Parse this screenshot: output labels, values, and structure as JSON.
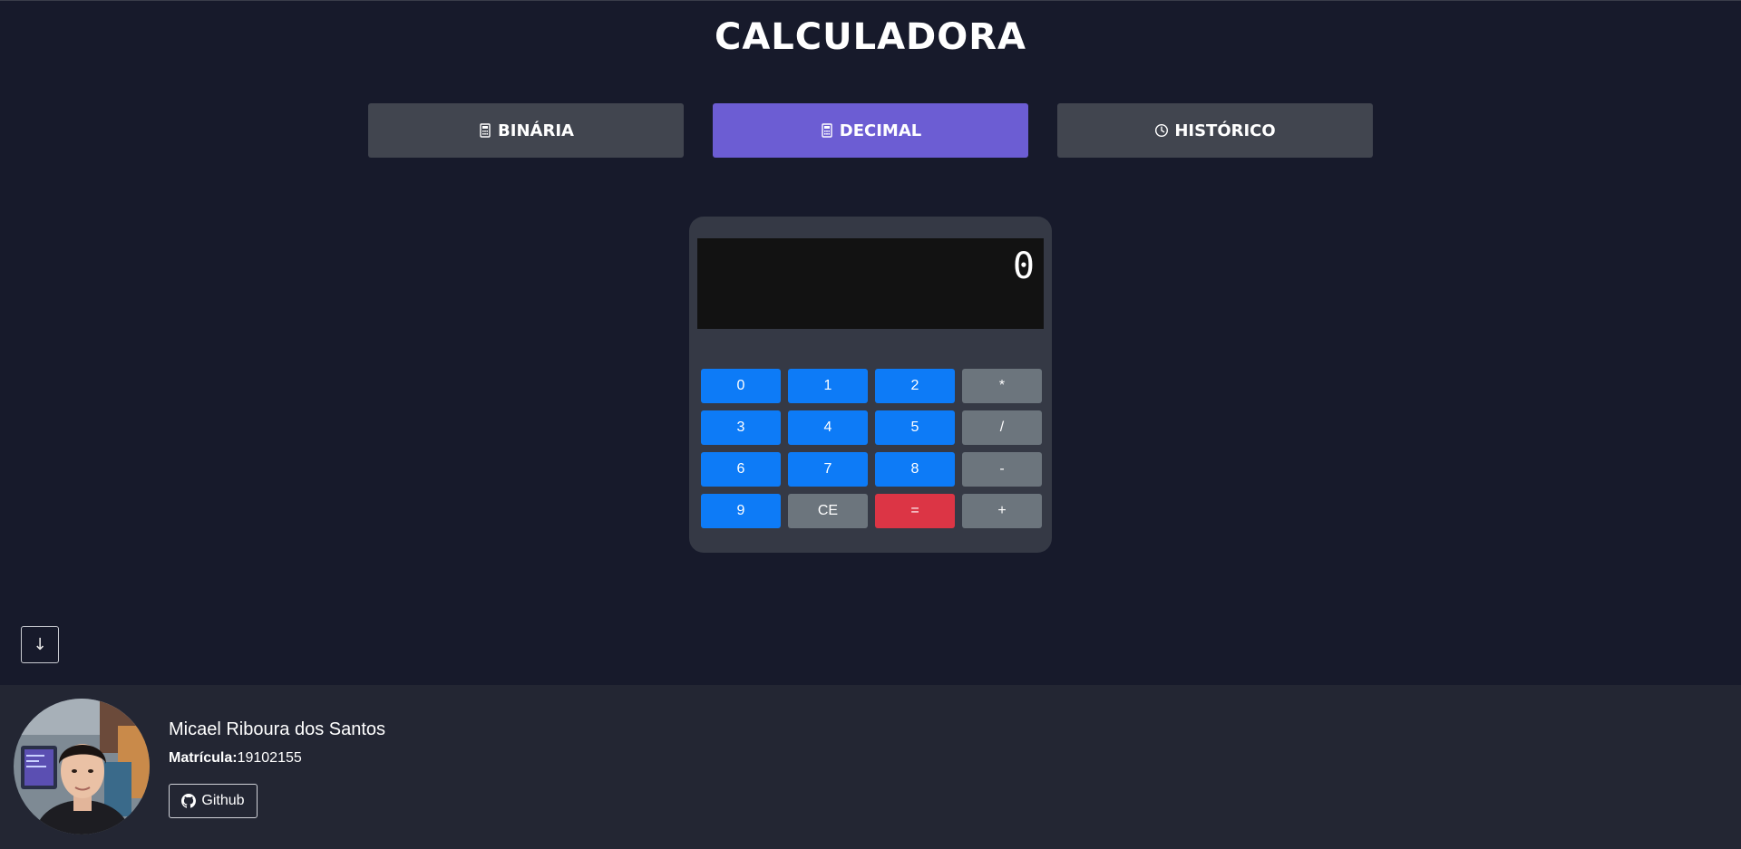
{
  "header": {
    "title": "CALCULADORA"
  },
  "tabs": [
    {
      "label": "BINÁRIA",
      "icon": "calculator-icon",
      "active": false
    },
    {
      "label": "DECIMAL",
      "icon": "calculator-icon",
      "active": true
    },
    {
      "label": "HISTÓRICO",
      "icon": "clock-icon",
      "active": false
    }
  ],
  "calculator": {
    "display": "0",
    "keys": [
      "0",
      "1",
      "2",
      "*",
      "3",
      "4",
      "5",
      "/",
      "6",
      "7",
      "8",
      "-",
      "9",
      "CE",
      "=",
      "+"
    ]
  },
  "scroll_button": {
    "symbol": "↓",
    "icon": "arrow-down-icon"
  },
  "footer": {
    "name": "Micael Riboura dos Santos",
    "matricula_label": "Matrícula:",
    "matricula_value": "19102155",
    "github_label": "Github"
  },
  "colors": {
    "background": "#171a2b",
    "footer": "#232633",
    "tab_active": "#6c5dd3",
    "tab_inactive": "#41454f",
    "key_number": "#0d7bf7",
    "key_operator": "#6c757d",
    "key_equals": "#dc3545"
  }
}
